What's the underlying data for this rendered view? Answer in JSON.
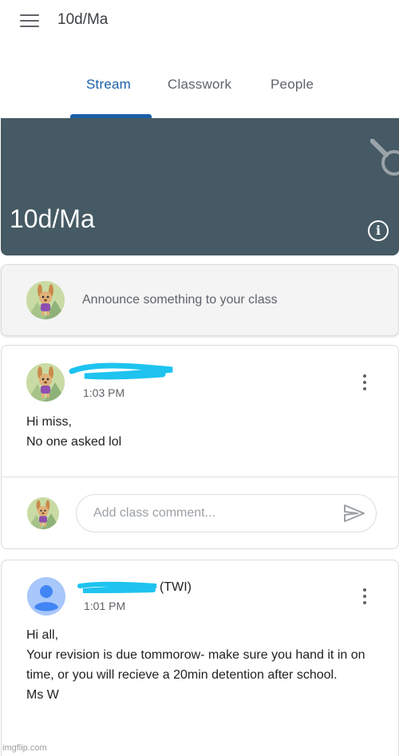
{
  "app": {
    "title": "10d/Ma"
  },
  "icons": {
    "menu": "hamburger-menu-icon",
    "info": "info-icon",
    "more": "more-vert-icon",
    "send": "send-icon"
  },
  "tabs": [
    {
      "label": "Stream",
      "active": true
    },
    {
      "label": "Classwork",
      "active": false
    },
    {
      "label": "People",
      "active": false
    }
  ],
  "banner": {
    "title": "10d/Ma",
    "color": "#455a64"
  },
  "announce": {
    "placeholder": "Announce something to your class"
  },
  "posts": [
    {
      "author_suffix": "",
      "time": "1:03 PM",
      "body": "Hi miss,\nNo one asked lol",
      "comment_placeholder": "Add class comment..."
    },
    {
      "author_suffix": "(TWI)",
      "time": "1:01 PM",
      "body": "Hi all,\nYour revision is due tommorow- make sure you hand it in on time, or you will recieve a 20min detention after school.\nMs W"
    }
  ],
  "watermark": "imgflip.com",
  "colors": {
    "accent": "#1a5fa8",
    "scribble": "#1ec3ef"
  }
}
